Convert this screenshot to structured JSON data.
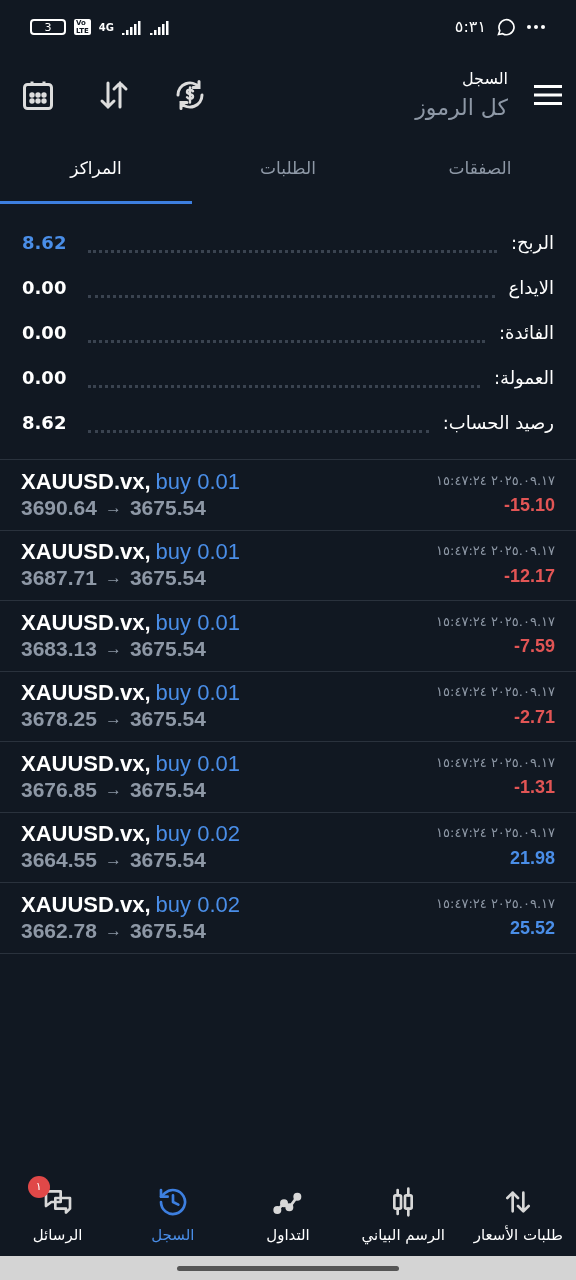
{
  "status_bar": {
    "time": "٥:٣١",
    "battery": "3",
    "volte_top": "Vo",
    "volte_bottom": "LTE",
    "network": "4G"
  },
  "header": {
    "title": "السجل",
    "subtitle": "كل الرموز"
  },
  "tabs": [
    {
      "label": "الصفقات",
      "selected": false
    },
    {
      "label": "الطلبات",
      "selected": false
    },
    {
      "label": "المراكز",
      "selected": true
    }
  ],
  "summary": [
    {
      "label": "الربح:",
      "value": "8.62",
      "highlight": true
    },
    {
      "label": "الايداع",
      "value": "0.00",
      "highlight": false
    },
    {
      "label": "الفائدة:",
      "value": "0.00",
      "highlight": false
    },
    {
      "label": "العمولة:",
      "value": "0.00",
      "highlight": false
    },
    {
      "label": "رصيد الحساب:",
      "value": "8.62",
      "highlight": false
    }
  ],
  "positions": [
    {
      "symbol": "XAUUSD.vx,",
      "side": "buy 0.01",
      "open": "3690.64",
      "arrow": "→",
      "close": "3675.54",
      "time": "٢٠٢٥.٠٩.١٧ ١٥:٤٧:٢٤",
      "profit": "-15.10",
      "kind": "loss"
    },
    {
      "symbol": "XAUUSD.vx,",
      "side": "buy 0.01",
      "open": "3687.71",
      "arrow": "→",
      "close": "3675.54",
      "time": "٢٠٢٥.٠٩.١٧ ١٥:٤٧:٢٤",
      "profit": "-12.17",
      "kind": "loss"
    },
    {
      "symbol": "XAUUSD.vx,",
      "side": "buy 0.01",
      "open": "3683.13",
      "arrow": "→",
      "close": "3675.54",
      "time": "٢٠٢٥.٠٩.١٧ ١٥:٤٧:٢٤",
      "profit": "-7.59",
      "kind": "loss"
    },
    {
      "symbol": "XAUUSD.vx,",
      "side": "buy 0.01",
      "open": "3678.25",
      "arrow": "→",
      "close": "3675.54",
      "time": "٢٠٢٥.٠٩.١٧ ١٥:٤٧:٢٤",
      "profit": "-2.71",
      "kind": "loss"
    },
    {
      "symbol": "XAUUSD.vx,",
      "side": "buy 0.01",
      "open": "3676.85",
      "arrow": "→",
      "close": "3675.54",
      "time": "٢٠٢٥.٠٩.١٧ ١٥:٤٧:٢٤",
      "profit": "-1.31",
      "kind": "loss"
    },
    {
      "symbol": "XAUUSD.vx,",
      "side": "buy 0.02",
      "open": "3664.55",
      "arrow": "→",
      "close": "3675.54",
      "time": "٢٠٢٥.٠٩.١٧ ١٥:٤٧:٢٤",
      "profit": "21.98",
      "kind": "profit"
    },
    {
      "symbol": "XAUUSD.vx,",
      "side": "buy 0.02",
      "open": "3662.78",
      "arrow": "→",
      "close": "3675.54",
      "time": "٢٠٢٥.٠٩.١٧ ١٥:٤٧:٢٤",
      "profit": "25.52",
      "kind": "profit"
    }
  ],
  "bottom_nav": [
    {
      "label": "طلبات الأسعار",
      "kind": "quotes",
      "selected": false
    },
    {
      "label": "الرسم البياني",
      "kind": "chart",
      "selected": false
    },
    {
      "label": "التداول",
      "kind": "trade",
      "selected": false
    },
    {
      "label": "السجل",
      "kind": "history",
      "selected": true
    },
    {
      "label": "الرسائل",
      "kind": "messages",
      "selected": false,
      "badge": "١"
    }
  ]
}
